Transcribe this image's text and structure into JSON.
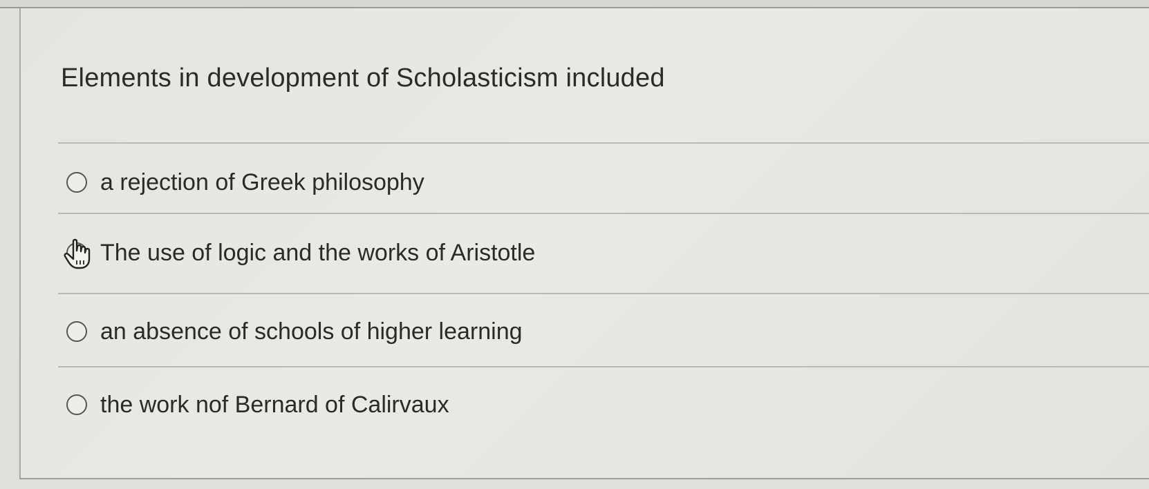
{
  "question": {
    "text": "Elements in development of Scholasticism included"
  },
  "options": [
    {
      "label": "a rejection of Greek philosophy",
      "selected": false
    },
    {
      "label": "The use of logic and the works of Aristotle",
      "selected": false
    },
    {
      "label": "an absence of schools of higher learning",
      "selected": false
    },
    {
      "label": "the work nof Bernard of Calirvaux",
      "selected": false
    }
  ],
  "cursor": {
    "icon": "hand-pointer-icon",
    "over_option": 2
  }
}
